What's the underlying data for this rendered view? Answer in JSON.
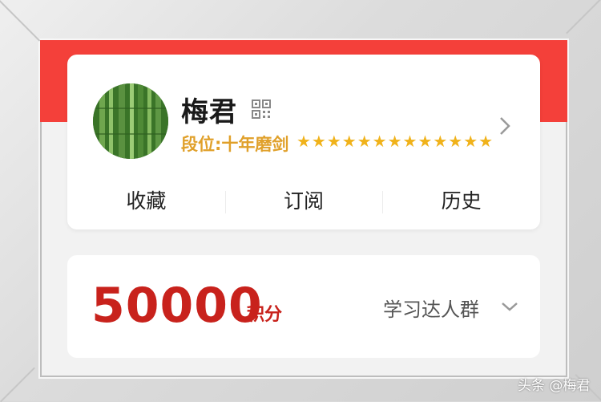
{
  "profile": {
    "name": "梅君",
    "rank_label": "段位:十年磨剑",
    "stars": "★★★★★★★★★★★★★",
    "star_count": 13,
    "avatar_icon": "bamboo-avatar",
    "qr_icon": "qr-code-icon",
    "more_icon": "chevron-right-icon"
  },
  "tabs": [
    {
      "label": "收藏"
    },
    {
      "label": "订阅"
    },
    {
      "label": "历史"
    }
  ],
  "points": {
    "value": "50000",
    "unit": "积分",
    "group": "学习达人群",
    "group_icon": "chevron-down-icon"
  },
  "watermark": "头条 @梅君",
  "colors": {
    "brand_red": "#f4403a",
    "points_red": "#c8221c",
    "gold": "#e0a02a",
    "star": "#f0b21a"
  }
}
